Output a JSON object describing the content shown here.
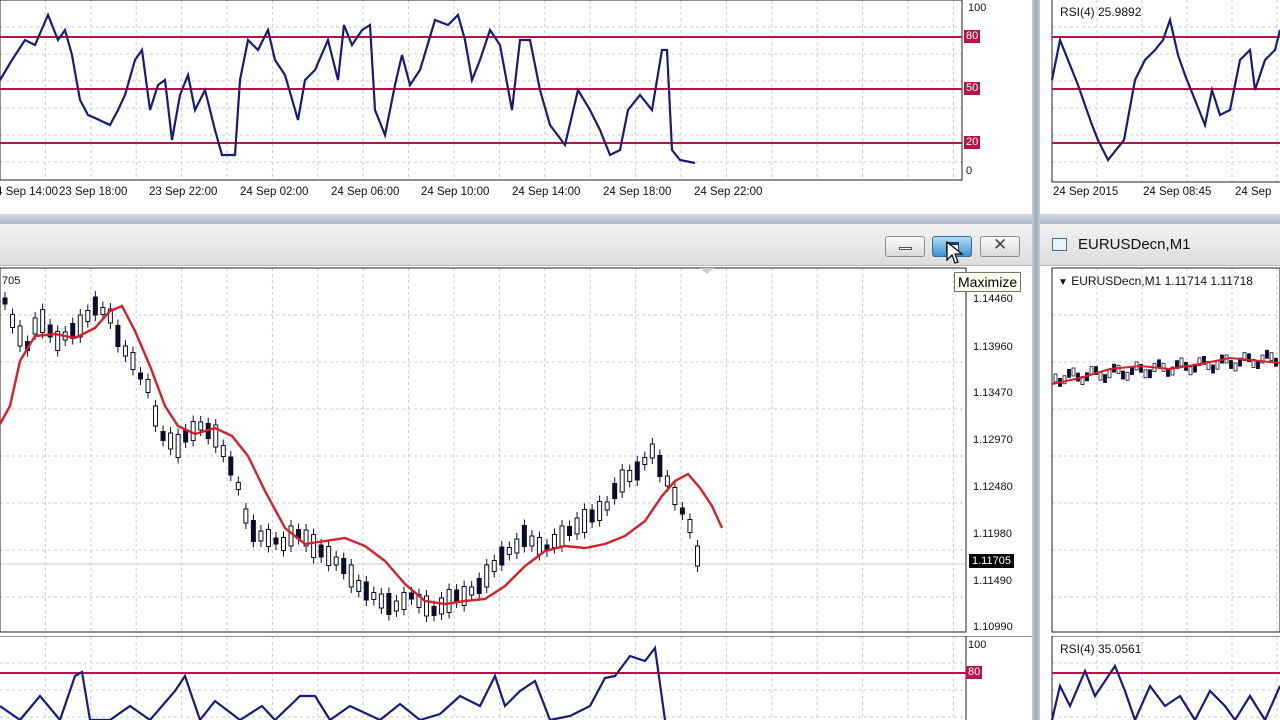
{
  "top_rsi": {
    "levels": [
      "100",
      "80",
      "50",
      "20",
      "0"
    ],
    "x_labels": [
      "4 Sep 14:00",
      "23 Sep 18:00",
      "23 Sep 22:00",
      "24 Sep 02:00",
      "24 Sep 06:00",
      "24 Sep 10:00",
      "24 Sep 14:00",
      "24 Sep 18:00",
      "24 Sep 22:00"
    ]
  },
  "right_top_rsi": {
    "label": "RSI(4) 25.9892",
    "x_labels": [
      "24 Sep 2015",
      "24 Sep 08:45",
      "24 Sep"
    ]
  },
  "main_window": {
    "price_label": "705",
    "price_ticks": [
      "1.14460",
      "1.13960",
      "1.13470",
      "1.12970",
      "1.12480",
      "1.11980",
      "1.11490",
      "1.10990"
    ],
    "current_price": "1.11705",
    "tooltip": "Maximize",
    "buttons": {
      "minimize": "minimize",
      "maximize": "maximize",
      "close": "close"
    }
  },
  "right_window": {
    "title": "EURUSDecn,M1",
    "header": "EURUSDecn,M1  1.11714 1.11718",
    "rsi_label": "RSI(4) 35.0561"
  },
  "bottom_rsi": {
    "levels": [
      "100",
      "80"
    ]
  },
  "colors": {
    "candles": "#0b0b2a",
    "ma_line": "#d8202a",
    "rsi_line": "#1a1a7a",
    "levels": "#b8144a",
    "grid": "#c9ccd3"
  }
}
